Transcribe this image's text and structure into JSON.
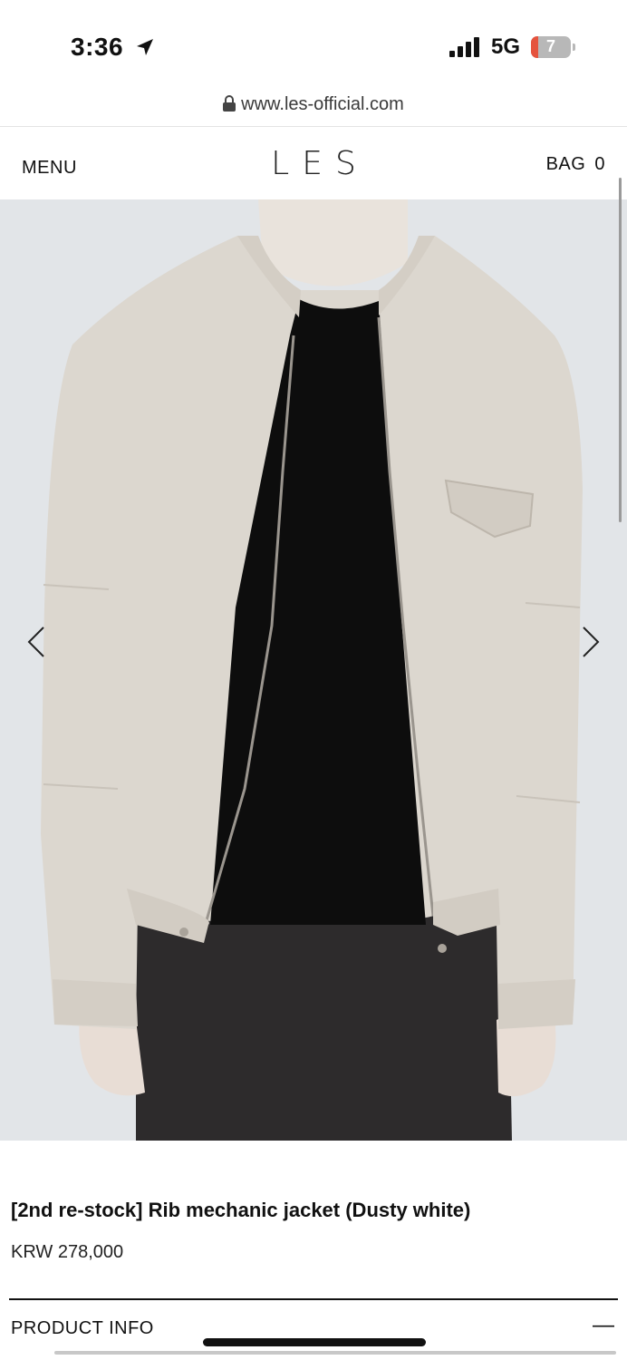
{
  "status": {
    "time": "3:36",
    "network": "5G",
    "battery": "7"
  },
  "browser": {
    "url": "www.les-official.com"
  },
  "header": {
    "menu_label": "MENU",
    "logo": "LES",
    "bag_label": "BAG",
    "bag_count": "0"
  },
  "product": {
    "title": "[2nd re-stock] Rib mechanic jacket (Dusty white)",
    "price": "KRW 278,000",
    "info_label": "PRODUCT INFO",
    "info_toggle": "—"
  },
  "colors": {
    "jacket": "#dcd7cf",
    "shirt": "#0d0d0d",
    "pants": "#2d2b2c",
    "background": "#e2e5e8"
  }
}
